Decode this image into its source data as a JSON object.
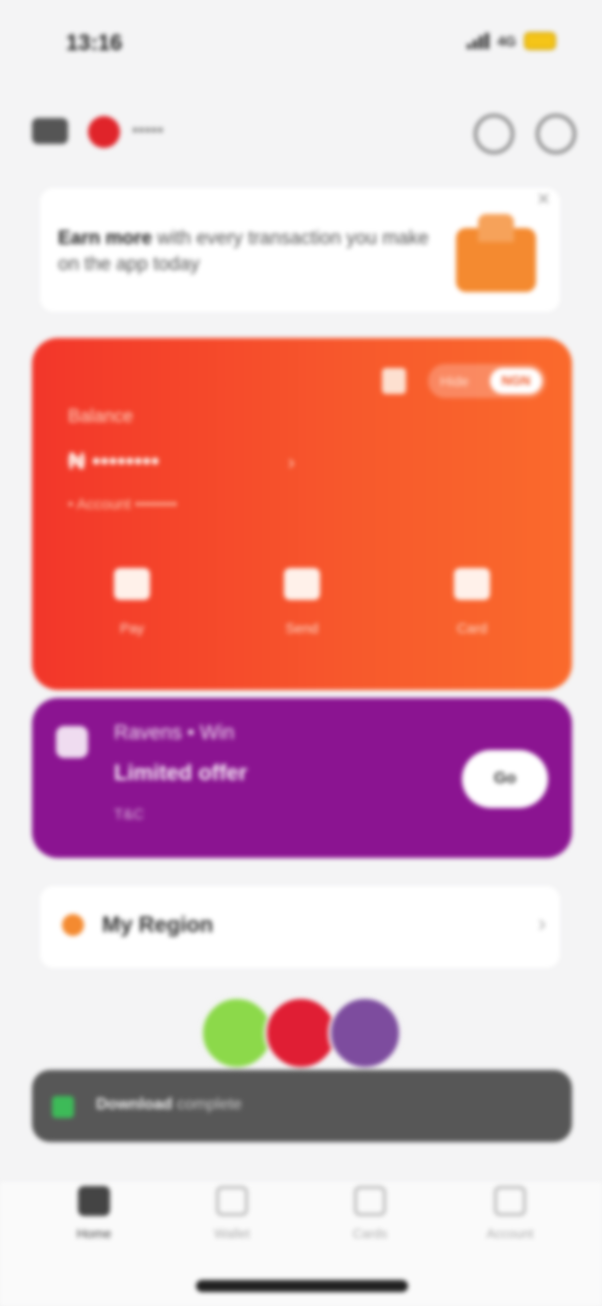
{
  "status_bar": {
    "time": "13:16",
    "network": "4G"
  },
  "header": {
    "account_name": "•••••",
    "support_icon": "headset-icon",
    "settings_icon": "gear-icon"
  },
  "promo_banner": {
    "text_bold": "Earn more",
    "text": "with every transaction you make on the app today",
    "close": "×",
    "icon": "gift-box-icon"
  },
  "wallet": {
    "toggle_a": "Hide",
    "toggle_b": "NGN",
    "label": "Balance",
    "balance": "₦ ••••••••",
    "chevron": "›",
    "sub": "• Account ••••••••",
    "actions": [
      {
        "icon": "percent-icon",
        "label": "Pay"
      },
      {
        "icon": "transfer-icon",
        "label": "Send"
      },
      {
        "icon": "card-icon",
        "label": "Card"
      }
    ],
    "colors": {
      "start": "#f2362a",
      "end": "#fa6a2c"
    }
  },
  "purple_promo": {
    "title": "Ravens • Win",
    "subtitle": "Limited offer",
    "small": "T&C",
    "button": "Go",
    "color": "#8b1491"
  },
  "region": {
    "title": "My Region",
    "chevron": "›"
  },
  "toast": {
    "bold": "Download",
    "text": "complete"
  },
  "tabs": [
    {
      "label": "Home",
      "icon": "home-icon",
      "active": true
    },
    {
      "label": "Wallet",
      "icon": "wallet-icon",
      "active": false
    },
    {
      "label": "Cards",
      "icon": "cards-icon",
      "active": false
    },
    {
      "label": "Account",
      "icon": "account-icon",
      "active": false
    }
  ]
}
